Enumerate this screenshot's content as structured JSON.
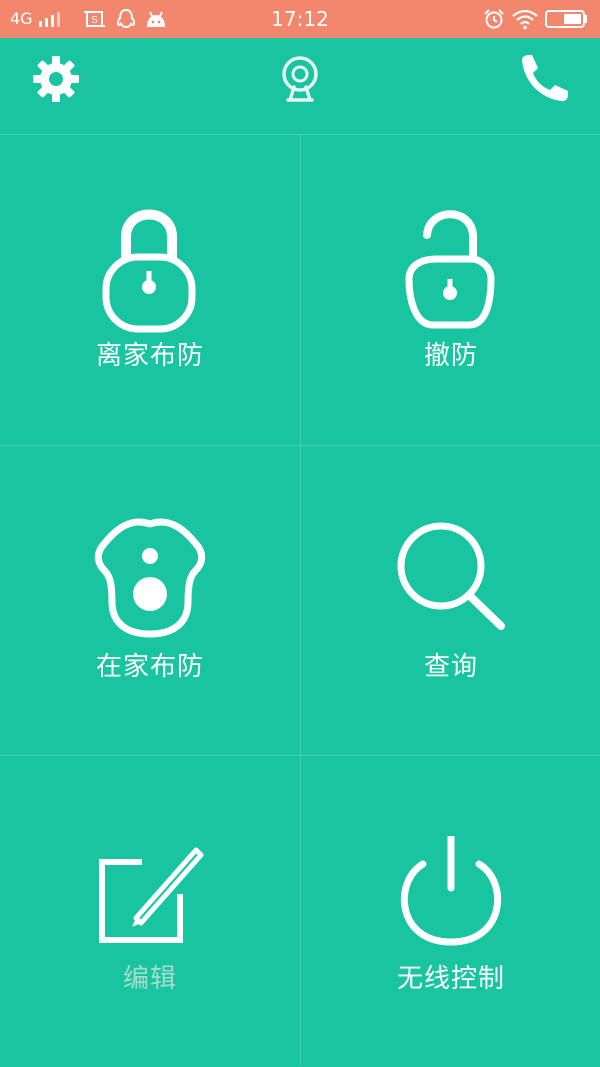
{
  "status_bar": {
    "network": "4G",
    "time": "17:12",
    "icons": [
      "signal-icon",
      "screenshot-icon",
      "qq-icon",
      "android-icon",
      "alarm-icon",
      "wifi-icon",
      "battery-icon"
    ]
  },
  "header": {
    "icons": [
      "settings-gear-icon",
      "camera-icon",
      "phone-icon"
    ]
  },
  "tiles": [
    {
      "label": "离家布防",
      "icon": "lock-closed-icon"
    },
    {
      "label": "撤防",
      "icon": "lock-open-icon"
    },
    {
      "label": "在家布防",
      "icon": "home-person-icon"
    },
    {
      "label": "查询",
      "icon": "search-icon"
    },
    {
      "label": "编辑",
      "icon": "edit-pencil-icon",
      "state": "disabled"
    },
    {
      "label": "无线控制",
      "icon": "power-icon"
    }
  ],
  "colors": {
    "background": "#19C4A1",
    "status_bar": "#F2876E",
    "label": "#FFFFFF",
    "muted_label": "#A7DCCD"
  }
}
